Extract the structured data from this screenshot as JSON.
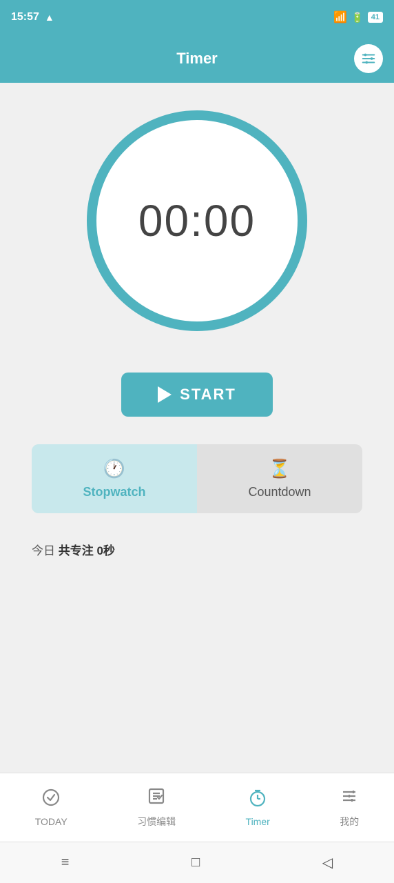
{
  "statusBar": {
    "time": "15:57",
    "warning": "▲",
    "battery": "41"
  },
  "header": {
    "title": "Timer",
    "settingsLabel": "settings"
  },
  "timer": {
    "display": "00:00"
  },
  "startButton": {
    "label": "START"
  },
  "tabs": [
    {
      "id": "stopwatch",
      "label": "Stopwatch",
      "icon": "🕐",
      "active": true
    },
    {
      "id": "countdown",
      "label": "Countdown",
      "icon": "⏳",
      "active": false
    }
  ],
  "todayFocus": {
    "prefix": "今日 ",
    "bold": "共专注 0秒"
  },
  "bottomNav": [
    {
      "id": "today",
      "label": "TODAY",
      "icon": "✓",
      "active": false
    },
    {
      "id": "habit",
      "label": "习惯编辑",
      "icon": "☑",
      "active": false
    },
    {
      "id": "timer",
      "label": "Timer",
      "icon": "⏰",
      "active": true
    },
    {
      "id": "profile",
      "label": "我的",
      "icon": "☰",
      "active": false
    }
  ],
  "systemNav": {
    "menu": "≡",
    "home": "□",
    "back": "◁"
  }
}
